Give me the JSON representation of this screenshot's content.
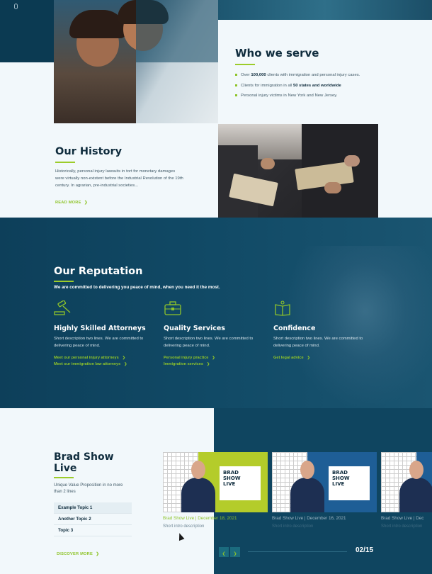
{
  "top_icon": "mouse-icon",
  "who_we_serve": {
    "title": "Who we serve",
    "items": [
      {
        "pre": "Over ",
        "bold": "100,000",
        "post": " clients with immigration and personal injury cases."
      },
      {
        "pre": "Clients for immigration in all ",
        "bold": "50 states and worldwide",
        "post": ""
      },
      {
        "pre": "Personal injury victims in New York and New Jersey.",
        "bold": "",
        "post": ""
      }
    ]
  },
  "history": {
    "title": "Our History",
    "body": "Historically, personal injury lawsuits in tort for monetary damages were virtually non-existent before the Industrial Revolution of the 19th century. In agrarian, pre-industrial societies...",
    "read_more": "READ MORE"
  },
  "reputation": {
    "title": "Our Reputation",
    "subtitle": "We are committed to delivering you peace of mind, when you need it the most.",
    "columns": [
      {
        "icon": "gavel-icon",
        "title": "Highly Skilled Attorneys",
        "desc": "Short description two lines. We are committed to delivering  peace of mind.",
        "links": [
          "Meet our personal injury attorneys",
          "Meet our immigration law attorneys"
        ]
      },
      {
        "icon": "briefcase-icon",
        "title": "Quality Services",
        "desc": "Short description two lines. We are committed to delivering  peace of mind.",
        "links": [
          "Personal injury practice",
          "Immigration services"
        ]
      },
      {
        "icon": "book-icon",
        "title": "Confidence",
        "desc": "Short description two lines. We are committed to delivering  peace of mind.",
        "links": [
          "Get legal advice"
        ]
      }
    ]
  },
  "show": {
    "title": "Brad Show Live",
    "uvp": "Unique Value Proposition in no more than 2 lines",
    "topics": [
      "Example Topic 1",
      "Another Topic 2",
      "Topic 3"
    ],
    "discover": "DISCOVER MORE",
    "cards": [
      {
        "title": "Brad Show Live | December 18, 2021",
        "desc": "Short intro description",
        "thumb_text": "BRAD SHOW LIVE",
        "theme": "#b4cc2a"
      },
      {
        "title": "Brad Show Live | December 16, 2021",
        "desc": "Short intro description",
        "thumb_text": "BRAD SHOW LIVE",
        "theme": "#1e5e96"
      },
      {
        "title": "Brad Show Live | Dec",
        "desc": "Short intro description",
        "thumb_text": "",
        "theme": "#1e5e96"
      }
    ],
    "pager": "02/15"
  },
  "colors": {
    "accent": "#8fc42a",
    "navy": "#0f4560",
    "dark_text": "#0f2c3d"
  }
}
